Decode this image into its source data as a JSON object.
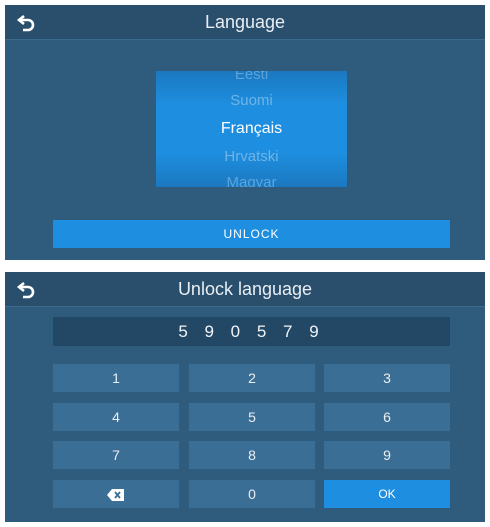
{
  "language_screen": {
    "title": "Language",
    "back_icon": "back-arrow-icon",
    "languages": [
      "Eesti",
      "Suomi",
      "Français",
      "Hrvatski",
      "Magyar"
    ],
    "selected": "Français",
    "unlock_label": "UNLOCK"
  },
  "unlock_screen": {
    "title": "Unlock language",
    "back_icon": "back-arrow-icon",
    "code": "5 9 0 5 7 9",
    "keys": {
      "k1": "1",
      "k2": "2",
      "k3": "3",
      "k4": "4",
      "k5": "5",
      "k6": "6",
      "k7": "7",
      "k8": "8",
      "k9": "9",
      "backspace_icon": "backspace-icon",
      "k0": "0",
      "ok": "OK"
    }
  },
  "colors": {
    "panel": "#2f5b7c",
    "accent": "#1e8fe0",
    "key": "#3b6e95",
    "display": "#234866"
  }
}
